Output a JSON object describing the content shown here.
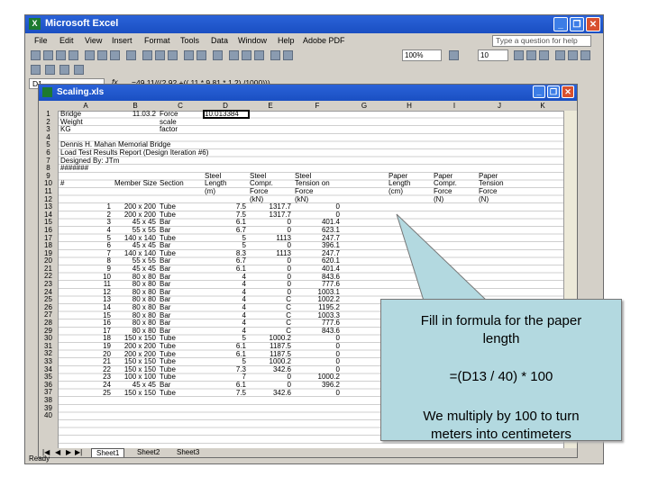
{
  "app": {
    "title": "Microsoft Excel",
    "icon": "excel-icon",
    "menu": [
      "File",
      "Edit",
      "View",
      "Insert",
      "Format",
      "Tools",
      "Data",
      "Window",
      "Help",
      "Adobe PDF"
    ],
    "help_placeholder": "Type a question for help",
    "zoom": "100%",
    "font_size": "10",
    "status": "Ready"
  },
  "formula_bar": {
    "name_box": "D1",
    "fx": "fx",
    "formula": "=49.11/((2.92 +(( 11 * 9.81 * 1.2) /1000)))"
  },
  "workbook": {
    "title": "Scaling.xls",
    "sheets": [
      "Sheet1",
      "Sheet2",
      "Sheet3"
    ],
    "columns": [
      "A",
      "B",
      "C",
      "D",
      "E",
      "F",
      "G",
      "H",
      "I",
      "J",
      "K"
    ],
    "header_cells": {
      "r1": [
        "Bridge",
        "11.03.2",
        "Force",
        "10.013384"
      ],
      "r2": [
        "Weight",
        "scale"
      ],
      "r3": [
        "KG",
        "factor"
      ],
      "r5": "Dennis H. Mahan  Memorial Bridge",
      "r6": "Load Test Results Report (Design Iteration #6)",
      "r7": "Designed By: JTm",
      "r8": "#######",
      "r9": [
        "Steel",
        "Steel",
        "Steel",
        "Paper",
        "Paper",
        "Paper"
      ],
      "r10": [
        "#",
        "Member Size",
        "Section",
        "Length",
        "Compr.",
        "Tension on",
        "Length",
        "Compr.",
        "Tension"
      ],
      "r11": [
        "(m)",
        "Force",
        "Force",
        "(cm)",
        "Force",
        "Force"
      ],
      "r12": [
        "(kN)",
        "(kN)",
        "(N)",
        "(N)"
      ]
    },
    "rows": [
      [
        "13",
        "1",
        "200 x 200",
        "Tube",
        "7.5",
        "1317.7",
        "0"
      ],
      [
        "14",
        "2",
        "200 x 200",
        "Tube",
        "7.5",
        "1317.7",
        "0"
      ],
      [
        "15",
        "3",
        "45 x 45",
        "Bar",
        "6.1",
        "0",
        "401.4"
      ],
      [
        "16",
        "4",
        "55 x 55",
        "Bar",
        "6.7",
        "0",
        "623.1"
      ],
      [
        "17",
        "5",
        "140 x 140",
        "Tube",
        "5",
        "1113",
        "247.7"
      ],
      [
        "18",
        "6",
        "45 x 45",
        "Bar",
        "5",
        "0",
        "396.1"
      ],
      [
        "19",
        "7",
        "140 x 140",
        "Tube",
        "8.3",
        "1113",
        "247.7"
      ],
      [
        "20",
        "8",
        "55 x 55",
        "Bar",
        "6.7",
        "0",
        "620.1"
      ],
      [
        "21",
        "9",
        "45 x 45",
        "Bar",
        "6.1",
        "0",
        "401.4"
      ],
      [
        "22",
        "10",
        "80 x 80",
        "Bar",
        "4",
        "0",
        "843.6"
      ],
      [
        "23",
        "11",
        "80 x 80",
        "Bar",
        "4",
        "0",
        "777.6"
      ],
      [
        "24",
        "12",
        "80 x 80",
        "Bar",
        "4",
        "0",
        "1003.1"
      ],
      [
        "25",
        "13",
        "80 x 80",
        "Bar",
        "4",
        "C",
        "1002.2"
      ],
      [
        "26",
        "14",
        "80 x 80",
        "Bar",
        "4",
        "C",
        "1195.2"
      ],
      [
        "27",
        "15",
        "80 x 80",
        "Bar",
        "4",
        "C",
        "1003.3"
      ],
      [
        "28",
        "16",
        "80 x 80",
        "Bar",
        "4",
        "C",
        "777.6"
      ],
      [
        "29",
        "17",
        "80 x 80",
        "Bar",
        "4",
        "C",
        "843.6"
      ],
      [
        "30",
        "18",
        "150 x 150",
        "Tube",
        "5",
        "1000.2",
        "0"
      ],
      [
        "31",
        "19",
        "200 x 200",
        "Tube",
        "6.1",
        "1187.5",
        "0"
      ],
      [
        "32",
        "20",
        "200 x 200",
        "Tube",
        "6.1",
        "1187.5",
        "0"
      ],
      [
        "33",
        "21",
        "150 x 150",
        "Tube",
        "5",
        "1000.2",
        "0"
      ],
      [
        "34",
        "22",
        "150 x 150",
        "Tube",
        "7.3",
        "342.6",
        "0"
      ],
      [
        "35",
        "23",
        "100 x 100",
        "Tube",
        "7",
        "0",
        "1000.2"
      ],
      [
        "36",
        "24",
        "45 x 45",
        "Bar",
        "6.1",
        "0",
        "396.2"
      ],
      [
        "37",
        "25",
        "150 x 150",
        "Tube",
        "7.5",
        "342.6",
        "0"
      ]
    ],
    "row_numbers": [
      "1",
      "2",
      "3",
      "4",
      "5",
      "6",
      "7",
      "8",
      "9",
      "10",
      "11",
      "12",
      "13",
      "14",
      "15",
      "16",
      "17",
      "18",
      "19",
      "20",
      "21",
      "22",
      "23",
      "24",
      "25",
      "26",
      "27",
      "28",
      "29",
      "30",
      "31",
      "32",
      "33",
      "34",
      "35",
      "36",
      "37",
      "38",
      "39",
      "40"
    ]
  },
  "callout": {
    "line1": "Fill in formula for the paper",
    "line2": "length",
    "formula": "=(D13 / 40) * 100",
    "line3": "We multiply by 100 to turn",
    "line4": "meters into centimeters",
    "bg": "#b3d9e0"
  }
}
